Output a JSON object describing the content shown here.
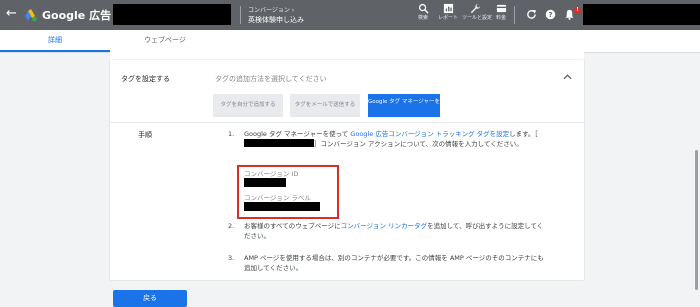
{
  "header": {
    "brand": "Google 広告",
    "breadcrumb_parent": "コンバージョン ›",
    "breadcrumb_current": "英検体験申し込み",
    "tools": [
      {
        "icon": "search-icon",
        "label": "検索"
      },
      {
        "icon": "report-icon",
        "label": "レポート"
      },
      {
        "icon": "wrench-icon",
        "label": "ツールと設定"
      },
      {
        "icon": "billing-icon",
        "label": "料金"
      }
    ],
    "notification_count": "!"
  },
  "tabs": [
    {
      "label": "詳細",
      "active": true
    },
    {
      "label": "ウェブページ",
      "active": false
    }
  ],
  "section": {
    "label": "タグを設定する",
    "hint": "タグの追加方法を選択してください",
    "options": [
      "タグを自分で追加する",
      "タグをメールで送信する",
      "Google タグ マネージャーを使用する"
    ]
  },
  "steps": {
    "label": "手順",
    "step1": {
      "num": "1.",
      "pre": "Google タグ マネージャーを使って ",
      "link": "Google 広告コンバージョン トラッキング タグを設定",
      "post1": "します。［",
      "post2": "］コンバージョン アクションについて、次の情報を入力してください。"
    },
    "conversion_id_label": "コンバージョン ID",
    "conversion_label_label": "コンバージョン ラベル",
    "step2": {
      "num": "2.",
      "pre": "お客様のすべてのウェブページに",
      "link": "コンバージョン リンカータグ",
      "post": "を追加して、呼び出すように設定してください。"
    },
    "step3": {
      "num": "3.",
      "text": "AMP ページを使用する場合は、別のコンテナが必要です。この情報を AMP ページのそのコンテナにも追加してください。"
    }
  },
  "footer": {
    "back_label": "戻る"
  },
  "colors": {
    "topbar": "#5f6368",
    "accent": "#1a73e8",
    "highlight": "#d93025"
  }
}
